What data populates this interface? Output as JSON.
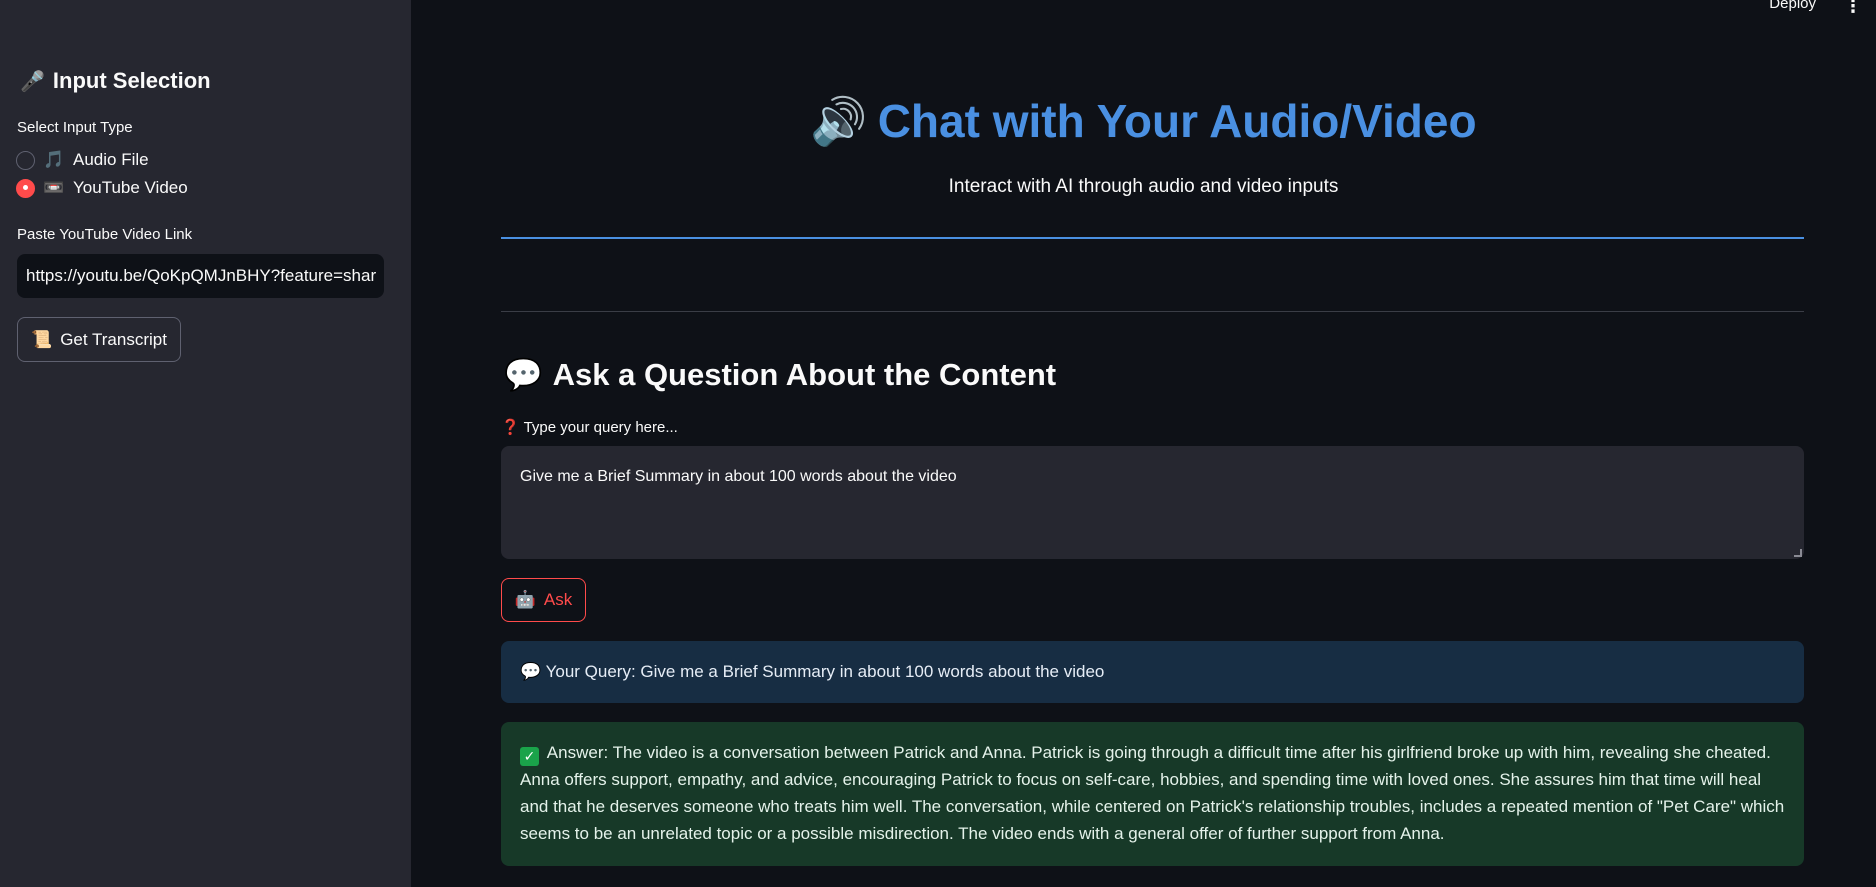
{
  "header": {
    "deploy_label": "Deploy",
    "menu_icon": "⋮"
  },
  "sidebar": {
    "title_icon": "🎤",
    "title": "Input Selection",
    "input_type_label": "Select Input Type",
    "options": [
      {
        "icon": "🎵",
        "label": "Audio File",
        "checked": false
      },
      {
        "icon": "📼",
        "label": "YouTube Video",
        "checked": true
      }
    ],
    "link_label": "Paste YouTube Video Link",
    "link_value": "https://youtu.be/QoKpQMJnBHY?feature=shar",
    "transcript_icon": "📜",
    "transcript_button": "Get Transcript"
  },
  "main": {
    "title_icon": "🔊",
    "title": "Chat with Your Audio/Video",
    "subtitle": "Interact with AI through audio and video inputs",
    "section_icon": "💬",
    "section_title": "Ask a Question About the Content",
    "query_label_icon": "❓",
    "query_label": "Type your query here...",
    "query_value": "Give me a Brief Summary in about 100 words about the video",
    "ask_icon": "🤖",
    "ask_button": "Ask",
    "query_display_icon": "💬",
    "query_display": "Your Query: Give me a Brief Summary in about 100 words about the video",
    "answer_icon": "✓",
    "answer": "Answer: The video is a conversation between Patrick and Anna. Patrick is going through a difficult time after his girlfriend broke up with him, revealing she cheated. Anna offers support, empathy, and advice, encouraging Patrick to focus on self-care, hobbies, and spending time with loved ones. She assures him that time will heal and that he deserves someone who treats him well. The conversation, while centered on Patrick's relationship troubles, includes a repeated mention of \"Pet Care\" which seems to be an unrelated topic or a possible misdirection. The video ends with a general offer of further support from Anna."
  },
  "colors": {
    "accent": "#ff4b4b",
    "title_blue": "#4a90e2",
    "sidebar_bg": "#262730",
    "main_bg": "#0e1117",
    "info_bg": "#172d43",
    "success_bg": "#173928"
  }
}
